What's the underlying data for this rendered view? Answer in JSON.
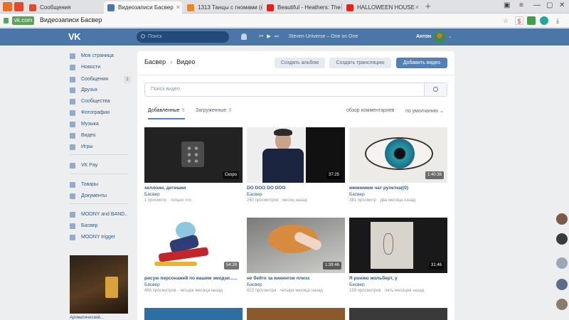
{
  "browser": {
    "tabs": [
      {
        "title": "Сообщения",
        "favicon_color": "#e24a2b",
        "active": false
      },
      {
        "title": "Видеозаписи Басвер",
        "favicon_color": "#4a76a8",
        "active": true
      },
      {
        "title": "1313 Танцы с гномами (сн",
        "favicon_color": "#f58220",
        "active": false
      },
      {
        "title": "Beautiful - Heathers: The M",
        "favicon_color": "#e62117",
        "active": false
      },
      {
        "title": "HALLOWEEN HOUSE",
        "favicon_color": "#e62117",
        "active": false
      }
    ],
    "new_tab_glyph": "+",
    "address": {
      "domain": "vk.com",
      "page_title": "Видеозаписи Басвер"
    }
  },
  "header": {
    "logo": "VK",
    "search_placeholder": "Поиск",
    "now_playing": "Steven Universe – One on One",
    "username": "Антон"
  },
  "menu": {
    "items": [
      {
        "label": "Моя страница",
        "icon": "home-icon"
      },
      {
        "label": "Новости",
        "icon": "news-icon"
      },
      {
        "label": "Сообщения",
        "icon": "messages-icon",
        "count": "1"
      },
      {
        "label": "Друзья",
        "icon": "friends-icon"
      },
      {
        "label": "Сообщества",
        "icon": "groups-icon"
      },
      {
        "label": "Фотографии",
        "icon": "photos-icon"
      },
      {
        "label": "Музыка",
        "icon": "music-icon"
      },
      {
        "label": "Видео",
        "icon": "video-icon"
      },
      {
        "label": "Игры",
        "icon": "games-icon"
      },
      {
        "label": "VK Pay",
        "icon": "vkpay-icon"
      },
      {
        "label": "Товары",
        "icon": "market-icon"
      },
      {
        "label": "Документы",
        "icon": "documents-icon"
      },
      {
        "label": "MOONY and BAND..",
        "icon": "community-icon"
      },
      {
        "label": "Басвер",
        "icon": "community-icon"
      },
      {
        "label": "MOONY trigger",
        "icon": "community-icon"
      }
    ],
    "ad_caption": "Ароматический..."
  },
  "page": {
    "crumb_root": "Басвер",
    "crumb_current": "Видео",
    "btn_album": "Создать альбом",
    "btn_stream": "Создать трансляцию",
    "btn_add": "Добавить видео",
    "search_placeholder": "Поиск видео",
    "tab_added": "Добавленные",
    "tab_added_count": "9",
    "tab_uploaded": "Загруженные",
    "tab_uploaded_count": "9",
    "filter_comments": "обзор комментариев",
    "filter_sort": "по умолчанию"
  },
  "videos": [
    {
      "title": "хеллоин, детишки",
      "author": "Басвер",
      "views": "1 просмотр",
      "date": "только что",
      "duration": "Скоро",
      "thumb": "placeholder"
    },
    {
      "title": "DO DOO DO DOO",
      "author": "Басвер",
      "views": "260 просмотров",
      "date": "месяц назад",
      "duration": "37:25",
      "thumb": "man"
    },
    {
      "title": "ммммммм чат рулетка((0)",
      "author": "Басвер",
      "views": "381 просмотр",
      "date": "два месяца назад",
      "duration": "1:40:36",
      "thumb": "eye"
    },
    {
      "title": "рисую персонажей по вашим эмодзи......",
      "author": "Басвер",
      "views": "466 просмотров",
      "date": "четыре месяца назад",
      "duration": "54:29",
      "thumb": "drawing"
    },
    {
      "title": "не бейте за викингов плизз",
      "author": "Басвер",
      "views": "823 просмотра",
      "date": "четыре месяца назад",
      "duration": "1:39:46",
      "thumb": "cat"
    },
    {
      "title": "Я роняю мольберт, у",
      "author": "Басвер",
      "views": "159 просмотров",
      "date": "пять месяцев назад",
      "duration": "31:46",
      "thumb": "easel"
    }
  ],
  "colors": {
    "vk_blue": "#4a76a8",
    "link": "#2a5885",
    "button_primary": "#5181b8"
  }
}
